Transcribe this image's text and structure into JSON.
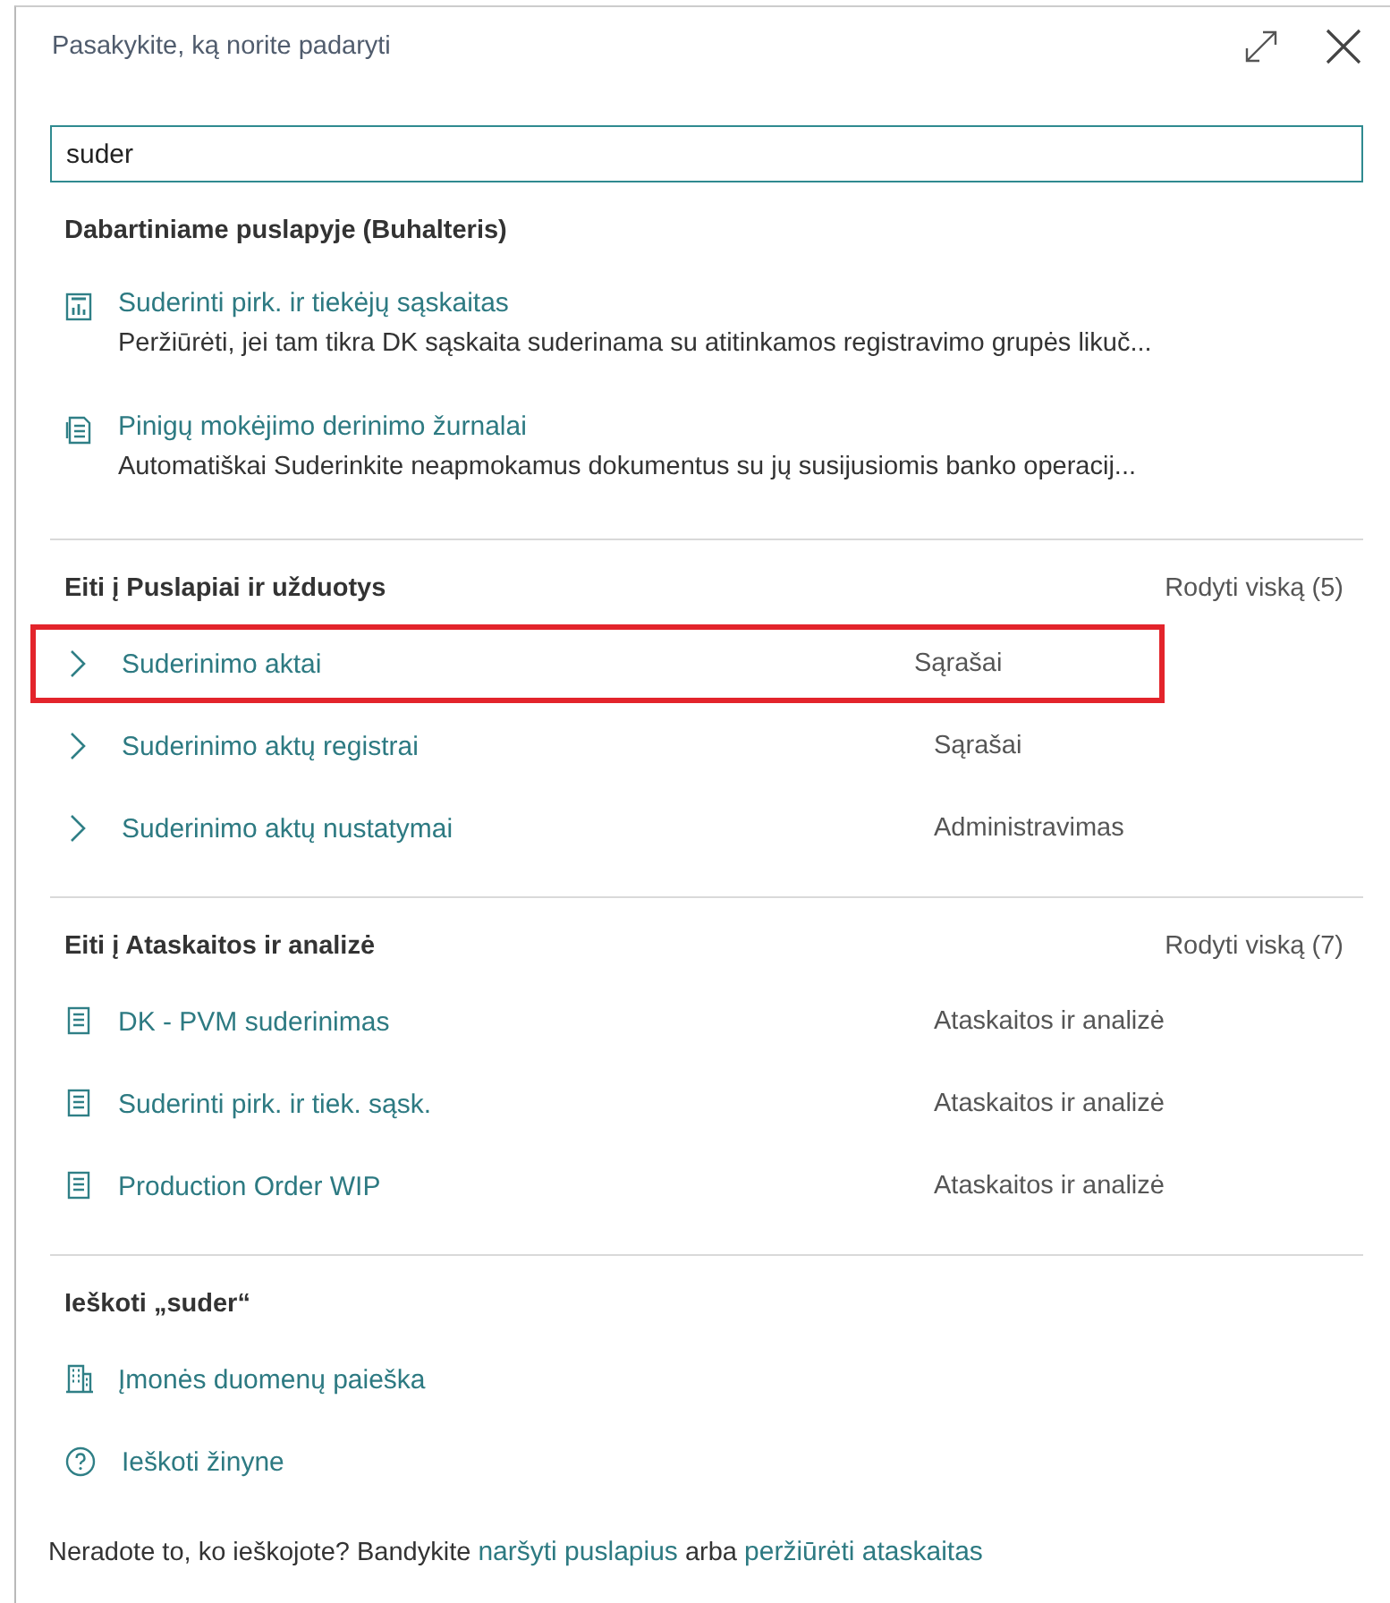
{
  "dialog": {
    "title": "Pasakykite, ką norite padaryti"
  },
  "search": {
    "value": "suder"
  },
  "sections": [
    {
      "kind": "actions",
      "heading": "Dabartiniame puslapyje (Buhalteris)",
      "items": [
        {
          "title": "Suderinti pirk. ir tiekėjų sąskaitas",
          "description": "Peržiūrėti, jei tam tikra DK sąskaita suderinama su atitinkamos registravimo grupės likuč..."
        },
        {
          "title": "Pinigų mokėjimo derinimo žurnalai",
          "description": "Automatiškai Suderinkite neapmokamus dokumentus su jų susijusiomis banko operacij..."
        }
      ]
    },
    {
      "kind": "pages",
      "heading": "Eiti į Puslapiai ir užduotys",
      "show_all": "Rodyti viską (5)",
      "items": [
        {
          "title": "Suderinimo aktai",
          "category": "Sąrašai",
          "highlighted": true
        },
        {
          "title": "Suderinimo aktų registrai",
          "category": "Sąrašai",
          "highlighted": false
        },
        {
          "title": "Suderinimo aktų nustatymai",
          "category": "Administravimas",
          "highlighted": false
        }
      ]
    },
    {
      "kind": "reports",
      "heading": "Eiti į Ataskaitos ir analizė",
      "show_all": "Rodyti viską (7)",
      "items": [
        {
          "title": "DK - PVM suderinimas",
          "category": "Ataskaitos ir analizė",
          "highlighted": false
        },
        {
          "title": "Suderinti pirk. ir tiek. sąsk.",
          "category": "Ataskaitos ir analizė",
          "highlighted": false
        },
        {
          "title": "Production Order WIP",
          "category": "Ataskaitos ir analizė",
          "highlighted": false
        }
      ]
    },
    {
      "kind": "search",
      "heading": "Ieškoti „suder“",
      "items": [
        {
          "title": "Įmonės duomenų paieška"
        },
        {
          "title": "Ieškoti žinyne"
        }
      ]
    }
  ],
  "footer": [
    {
      "kind": "text",
      "text": "Neradote to, ko ieškojote? Bandykite "
    },
    {
      "kind": "link",
      "text": "naršyti puslapius"
    },
    {
      "kind": "text",
      "text": " arba "
    },
    {
      "kind": "link",
      "text": "peržiūrėti ataskaitas"
    }
  ]
}
